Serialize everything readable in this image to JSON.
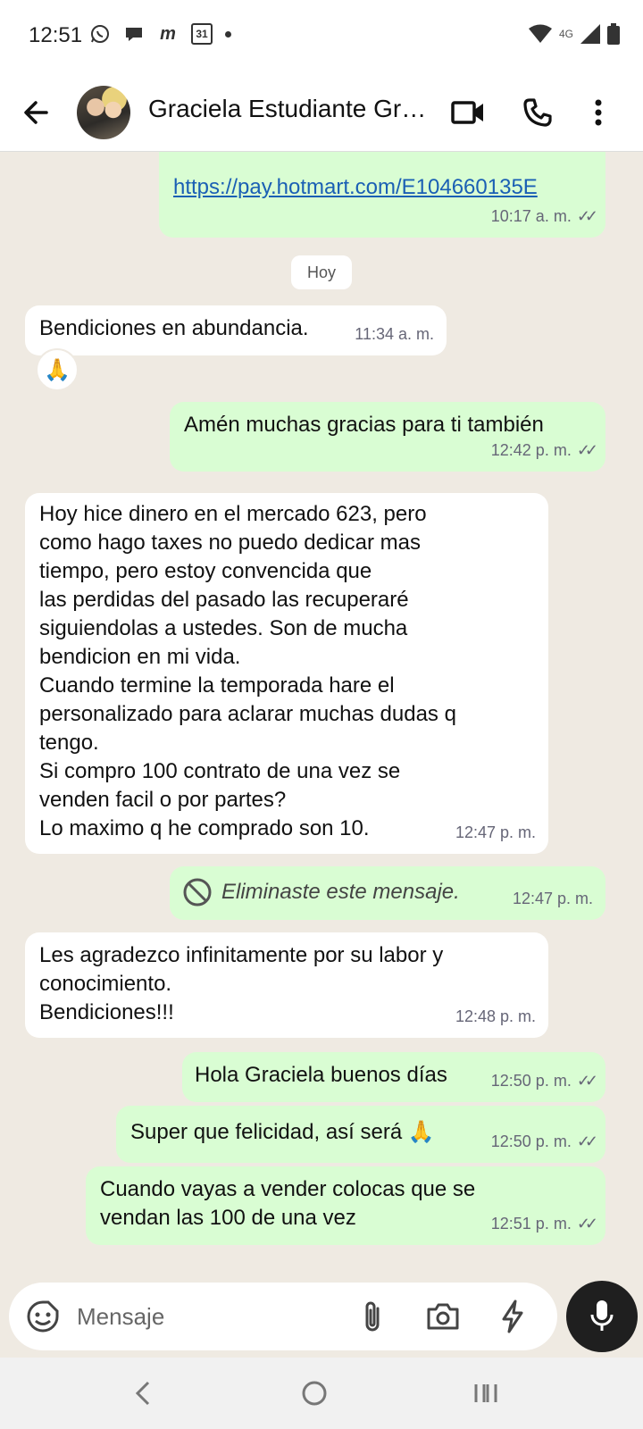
{
  "status_bar": {
    "time": "12:51",
    "calendar_day": "31",
    "network": "4G",
    "icons_left": [
      "whatsapp-icon",
      "chat-icon",
      "m-icon",
      "calendar-icon",
      "dot-icon"
    ],
    "icons_right": [
      "wifi-icon",
      "signal-icon",
      "battery-icon"
    ]
  },
  "header": {
    "title": "Graciela Estudiante Gr…",
    "icons": [
      "back-arrow-icon",
      "video-call-icon",
      "phone-icon",
      "more-vert-icon"
    ]
  },
  "chat": {
    "day_separator": "Hoy",
    "messages": [
      {
        "dir": "out",
        "text": "https://pay.hotmart.com/E104660135E",
        "time": "10:17 a. m.",
        "read": true
      },
      {
        "dir": "in",
        "text": "Bendiciones en abundancia.",
        "time": "11:34 a. m.",
        "reaction": "🙏"
      },
      {
        "dir": "out",
        "text": "Amén muchas gracias para ti también",
        "time": "12:42 p. m.",
        "read": true
      },
      {
        "dir": "in",
        "text": "Hoy hice dinero en el mercado 623, pero\ncomo hago taxes no puedo dedicar mas\ntiempo, pero estoy convencida  que\nlas perdidas del pasado las recuperaré\nsiguiendolas a ustedes. Son de mucha\nbendicion en mi vida.\nCuando termine la temporada hare el\npersonalizado para aclarar muchas dudas q\ntengo.\nSi compro 100 contrato  de una vez se\nvenden facil o por partes?\nLo maximo q he comprado son 10.",
        "time": "12:47 p. m."
      },
      {
        "dir": "out",
        "text": "Eliminaste este mensaje.",
        "time": "12:47 p. m.",
        "deleted": true
      },
      {
        "dir": "in",
        "text": "Les agradezco infinitamente por su labor y\nconocimiento.\nBendiciones!!!",
        "time": "12:48 p. m."
      },
      {
        "dir": "out",
        "text": "Hola Graciela buenos días",
        "time": "12:50 p. m.",
        "read": true
      },
      {
        "dir": "out",
        "text": "Super que felicidad, así será 🙏",
        "time": "12:50 p. m.",
        "read": true
      },
      {
        "dir": "out",
        "text": "Cuando vayas a vender colocas que se\nvendan las 100 de una vez",
        "time": "12:51 p. m.",
        "read": true
      }
    ]
  },
  "composer": {
    "placeholder": "Mensaje",
    "icons": [
      "sticker-icon",
      "attach-icon",
      "camera-icon",
      "bolt-icon",
      "mic-icon"
    ]
  },
  "colors": {
    "incoming": "#ffffff",
    "outgoing": "#d9fdd3",
    "wallpaper": "#efeae2",
    "link": "#1a5fb4"
  }
}
